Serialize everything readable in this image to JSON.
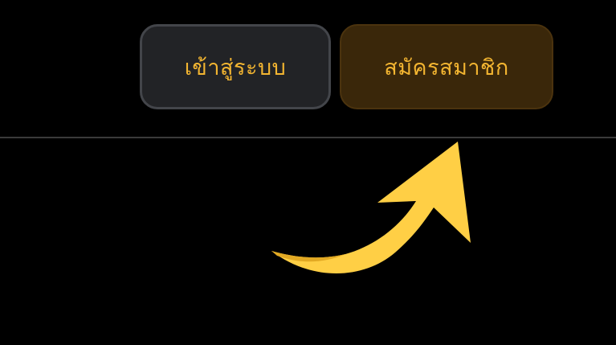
{
  "header": {
    "login_label": "เข้าสู่ระบบ",
    "register_label": "สมัครสมาชิก"
  },
  "colors": {
    "background": "#000000",
    "accent_text": "#f3b531",
    "login_bg": "#222326",
    "register_bg": "#3a270a",
    "divider": "#3a3a3a",
    "arrow": "#ffcf45"
  },
  "icons": {
    "pointer": "curved-arrow-icon"
  }
}
